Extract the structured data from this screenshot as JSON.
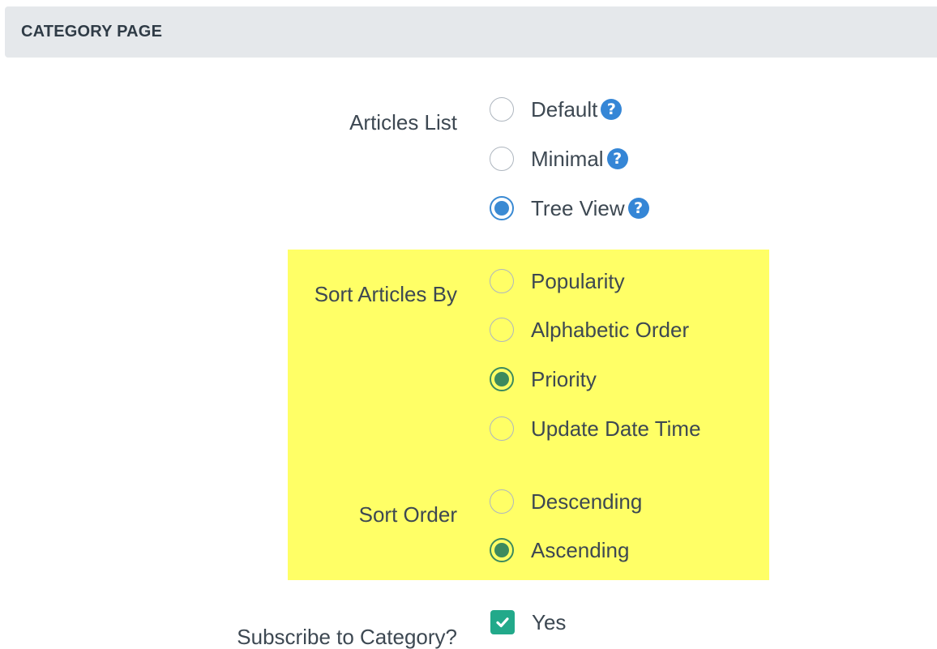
{
  "section": {
    "title": "CATEGORY PAGE"
  },
  "articles_list": {
    "label": "Articles List",
    "options": [
      {
        "label": "Default",
        "checked": false
      },
      {
        "label": "Minimal",
        "checked": false
      },
      {
        "label": "Tree View",
        "checked": true
      }
    ],
    "help_glyph": "?"
  },
  "sort_by": {
    "label": "Sort Articles By",
    "options": [
      {
        "label": "Popularity",
        "checked": false
      },
      {
        "label": "Alphabetic Order",
        "checked": false
      },
      {
        "label": "Priority",
        "checked": true
      },
      {
        "label": "Update Date Time",
        "checked": false
      }
    ]
  },
  "sort_order": {
    "label": "Sort Order",
    "options": [
      {
        "label": "Descending",
        "checked": false
      },
      {
        "label": "Ascending",
        "checked": true
      }
    ]
  },
  "subscribe": {
    "label": "Subscribe to Category?",
    "checkbox_label": "Yes",
    "checked": true
  },
  "colors": {
    "header_bg": "#e5e8eb",
    "highlight": "#ffff66",
    "radio_blue": "#3a8ad3",
    "radio_green": "#3d8a5d",
    "checkbox": "#22a98a",
    "help_icon": "#3586d6"
  },
  "icons": {
    "help": "question-circle-icon",
    "check": "checkmark-icon"
  }
}
